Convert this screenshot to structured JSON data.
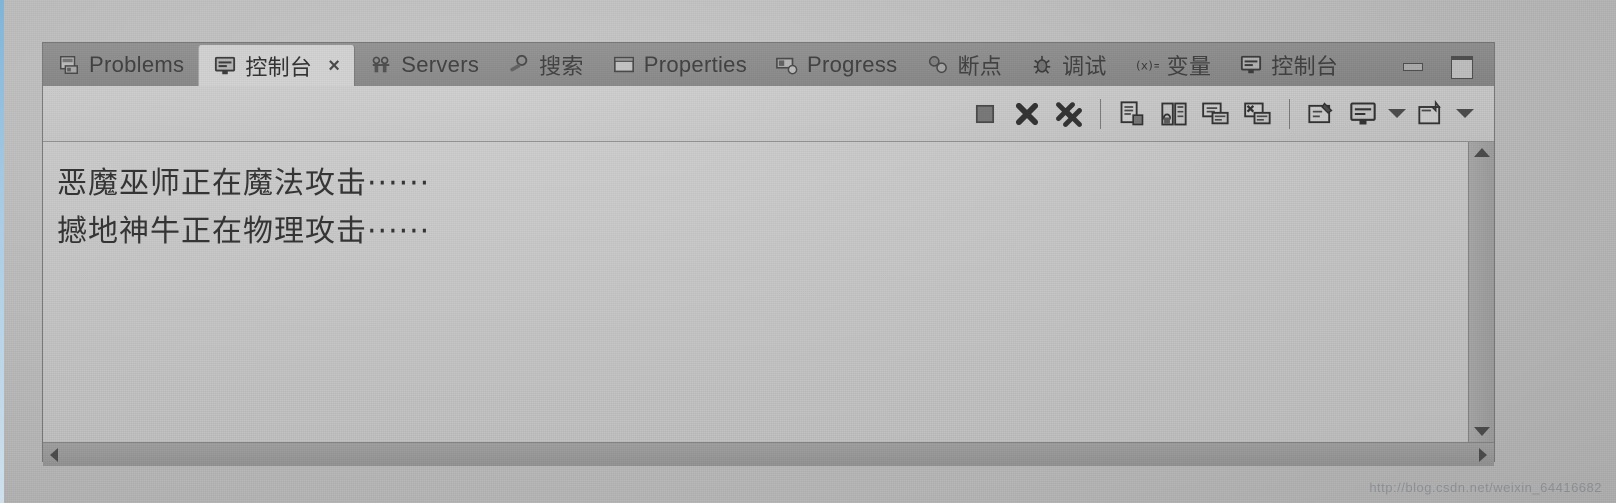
{
  "window": {
    "minimize_label": "Minimize",
    "maximize_label": "Maximize"
  },
  "tabs": [
    {
      "label": "Problems",
      "icon": "problems-icon",
      "active": false,
      "closable": false
    },
    {
      "label": "控制台",
      "icon": "console-icon",
      "active": true,
      "closable": true,
      "close_label": "×"
    },
    {
      "label": "Servers",
      "icon": "servers-icon",
      "active": false,
      "closable": false
    },
    {
      "label": "搜索",
      "icon": "search-icon",
      "active": false,
      "closable": false
    },
    {
      "label": "Properties",
      "icon": "properties-icon",
      "active": false,
      "closable": false
    },
    {
      "label": "Progress",
      "icon": "progress-icon",
      "active": false,
      "closable": false
    },
    {
      "label": "断点",
      "icon": "breakpoints-icon",
      "active": false,
      "closable": false
    },
    {
      "label": "调试",
      "icon": "debug-icon",
      "active": false,
      "closable": false
    },
    {
      "label": "变量",
      "icon": "variables-icon",
      "active": false,
      "closable": false
    },
    {
      "label": "控制台",
      "icon": "console-icon",
      "active": false,
      "closable": false
    }
  ],
  "toolbar": {
    "items": [
      {
        "name": "terminate-button",
        "icon": "stop-square-icon",
        "type": "button"
      },
      {
        "name": "remove-launch-button",
        "icon": "remove-x-icon",
        "type": "button"
      },
      {
        "name": "remove-all-launches-button",
        "icon": "remove-all-xx-icon",
        "type": "button"
      },
      {
        "name": "toolbar-separator-1",
        "icon": "separator",
        "type": "separator"
      },
      {
        "name": "clear-console-button",
        "icon": "clear-console-icon",
        "type": "button"
      },
      {
        "name": "scroll-lock-button",
        "icon": "scroll-lock-icon",
        "type": "button"
      },
      {
        "name": "show-console-button",
        "icon": "show-console-icon",
        "type": "button"
      },
      {
        "name": "pin-console-button",
        "icon": "pin-console-icon",
        "type": "button"
      },
      {
        "name": "toolbar-separator-2",
        "icon": "separator",
        "type": "separator"
      },
      {
        "name": "word-wrap-button",
        "icon": "word-wrap-icon",
        "type": "button"
      },
      {
        "name": "display-selected-console-button",
        "icon": "display-console-icon",
        "type": "button"
      },
      {
        "name": "display-selected-console-dropdown",
        "icon": "chevron-down-icon",
        "type": "dropdown"
      },
      {
        "name": "open-console-button",
        "icon": "open-console-icon",
        "type": "button"
      },
      {
        "name": "open-console-dropdown",
        "icon": "chevron-down-icon",
        "type": "dropdown"
      }
    ]
  },
  "console": {
    "lines": [
      "恶魔巫师正在魔法攻击······",
      "撼地神牛正在物理攻击······"
    ]
  },
  "scrollbars": {
    "vertical": {
      "up_label": "scroll up",
      "down_label": "scroll down"
    },
    "horizontal": {
      "left_label": "scroll left",
      "right_label": "scroll right"
    }
  },
  "watermark": "http://blog.csdn.net/weixin_64416682",
  "colors": {
    "tab_strip": "#a3a3a3",
    "active_tab": "#efefef",
    "panel_bg": "#e6e6e6",
    "text": "#3d3d3d",
    "scrollbar": "#b8b8b8"
  }
}
